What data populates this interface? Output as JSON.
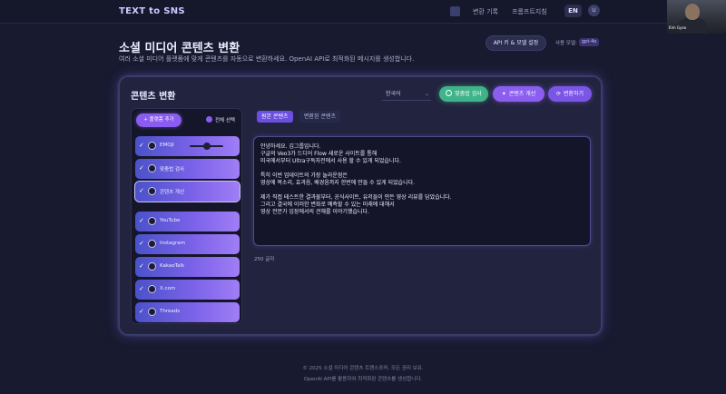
{
  "navbar": {
    "brand": "TEXT to SNS",
    "links": [
      "변환 기록",
      "프롬프트지침"
    ],
    "lang": "EN",
    "avatar": "U",
    "webcam_name": "Kim Gyeo"
  },
  "header": {
    "title": "소셜 미디어 콘텐츠 변환",
    "subtitle": "여러 소셜 미디어 플랫폼에 맞게 콘텐츠를 자동으로 변환하세요. OpenAI API로 최적화된 메시지를 생성합니다.",
    "api_button": "API 키 & 모델 설정",
    "model_label": "사용 모델:",
    "model_value": "gpt-4o"
  },
  "card": {
    "title": "콘텐츠 변환",
    "language": "한국어",
    "buttons": {
      "check": "맞춤법 검사",
      "improve": "콘텐츠 개선",
      "convert": "변환하기"
    },
    "add_platform": "+ 플랫폼 추가",
    "select_all": "전체 선택",
    "platforms": [
      {
        "label": "EMOJI",
        "icon": "emoji-icon"
      },
      {
        "label": "맞춤법 검사",
        "icon": "spellcheck-icon"
      },
      {
        "label": "콘텐츠 개선",
        "icon": "sparkle-icon"
      },
      {
        "label": "YouTube",
        "icon": "youtube-icon"
      },
      {
        "label": "Instagram",
        "icon": "instagram-icon"
      },
      {
        "label": "KakaoTalk",
        "icon": "kakaotalk-icon"
      },
      {
        "label": "X.com",
        "icon": "x-icon"
      },
      {
        "label": "Threads",
        "icon": "threads-icon"
      }
    ],
    "tabs": {
      "original": "원본 콘텐츠",
      "converted": "변환된 콘텐츠"
    },
    "content_lines": [
      "안녕하세요. 김그룹입니다.",
      "구글의 Veo3가 드디어 Flow 새로운 사이트를 통해",
      "미국에서부터 Ultra구독자전에서 사용 할 수 있게 되었습니다.",
      "",
      "특히 이번 업데이트의 가장 놀라운점은",
      "영상에 목소리, 효과음, 배경음까지 한번에 만들 수 있게 되었습니다.",
      "",
      "제가 직접 테스트한 결과물부터, 공식사이트, 유저들이 만든 영상 리뷰를 담았습니다.",
      "그리고 결국에 이러한 변화로 예측할 수 있는 미래에 대해서",
      "영상 전문가 입장에서의 견해를 이야기했습니다."
    ],
    "char_count": "250 글자"
  },
  "footer": {
    "copyright": "© 2025 소셜 미디어 콘텐츠 트랜스포머. 모든 권리 보유.",
    "note": "OpenAI API를 활용하여 최적화된 콘텐츠를 생성합니다."
  }
}
